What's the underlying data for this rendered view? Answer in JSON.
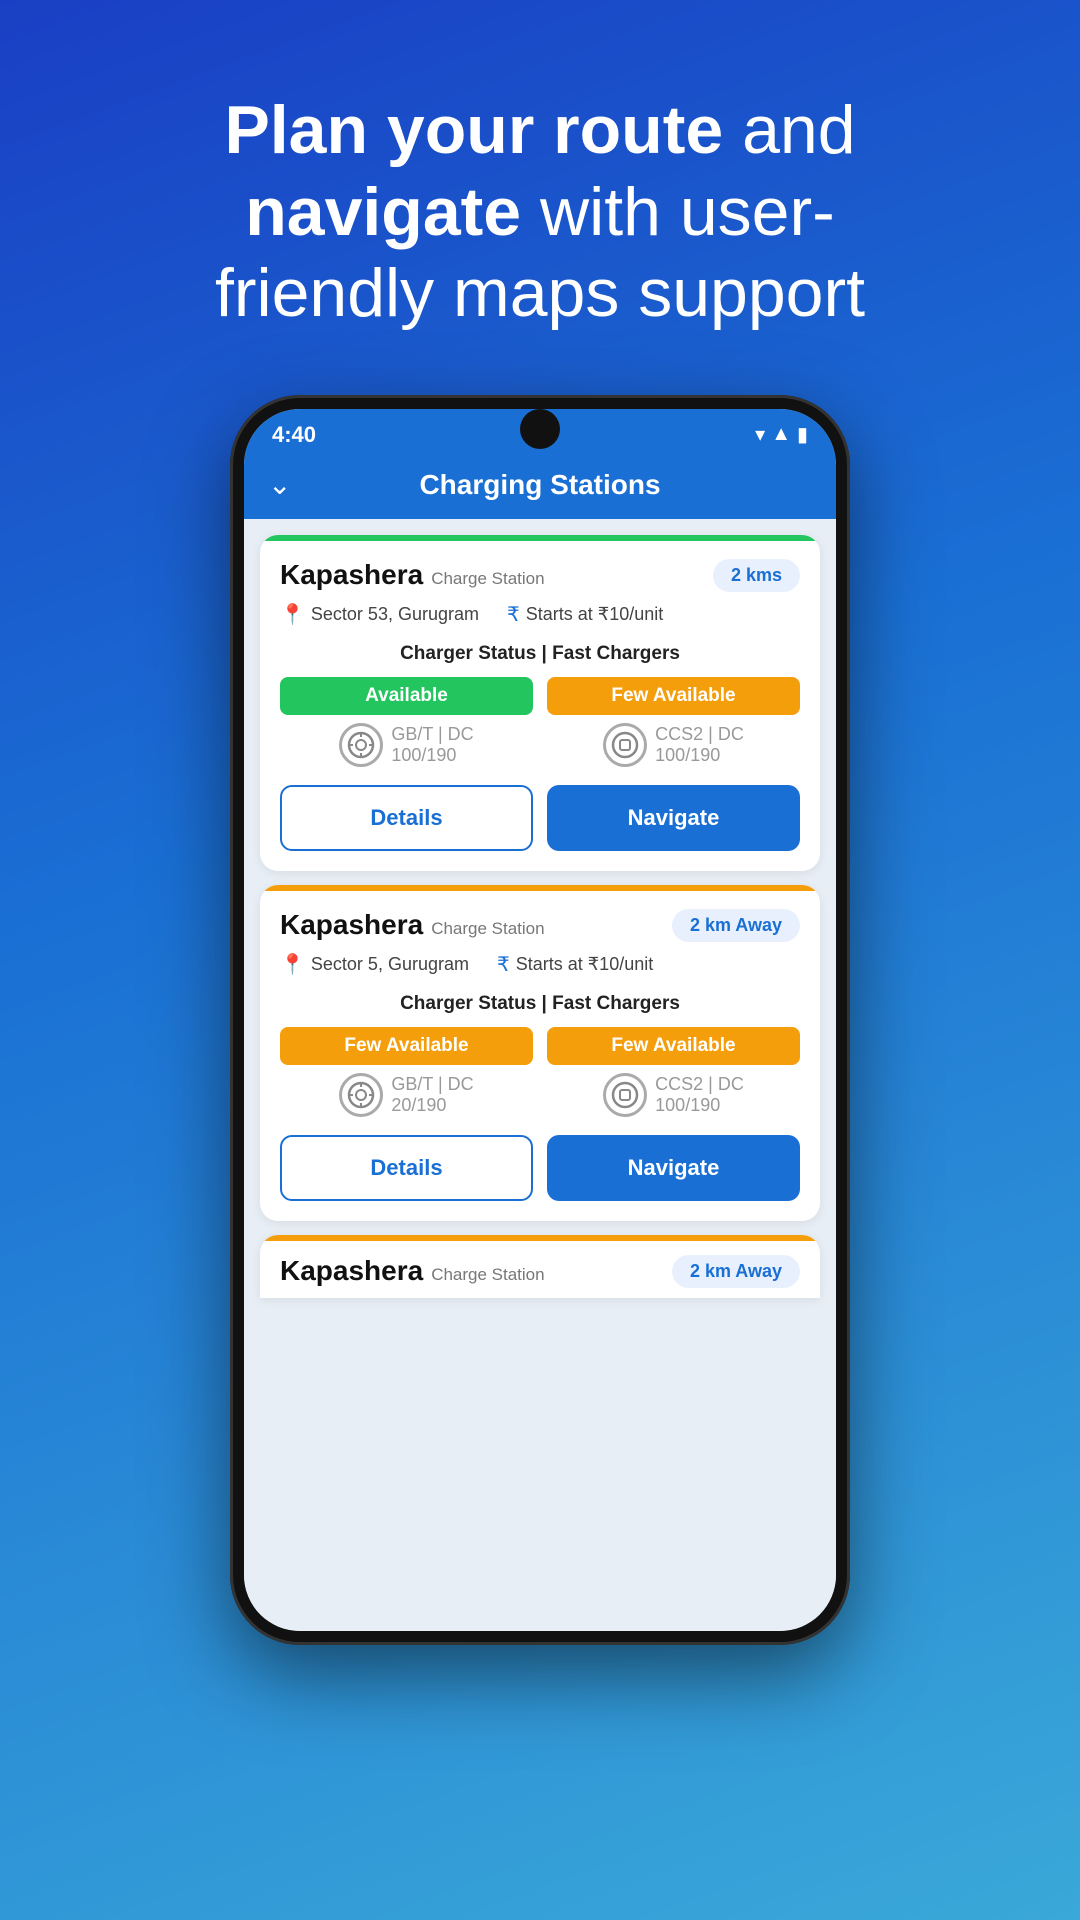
{
  "hero": {
    "title_part1": "Plan your route",
    "title_part2": "and",
    "title_part3": "navigate",
    "title_part4": "with user-friendly maps support"
  },
  "status_bar": {
    "time": "4:40",
    "wifi": "▼",
    "signal": "▲",
    "battery": "▮"
  },
  "app_header": {
    "back_icon": "⌄",
    "title": "Charging Stations"
  },
  "stations": [
    {
      "id": "station-1",
      "name": "Kapashera",
      "type": "Charge Station",
      "distance": "2 kms",
      "location": "Sector 53, Gurugram",
      "price": "Starts at ₹10/unit",
      "top_bar_color": "green",
      "charger_status_label": "Charger Status | Fast Chargers",
      "chargers": [
        {
          "status": "Available",
          "status_class": "available",
          "type": "GB/T | DC",
          "current": "100",
          "total": "190"
        },
        {
          "status": "Few Available",
          "status_class": "few-available",
          "type": "CCS2 | DC",
          "current": "100",
          "total": "190"
        }
      ],
      "details_label": "Details",
      "navigate_label": "Navigate"
    },
    {
      "id": "station-2",
      "name": "Kapashera",
      "type": "Charge Station",
      "distance": "2 km Away",
      "location": "Sector 5, Gurugram",
      "price": "Starts at ₹10/unit",
      "top_bar_color": "yellow",
      "charger_status_label": "Charger Status | Fast Chargers",
      "chargers": [
        {
          "status": "Few Available",
          "status_class": "few-available",
          "type": "GB/T | DC",
          "current": "20",
          "total": "190"
        },
        {
          "status": "Few Available",
          "status_class": "few-available",
          "type": "CCS2 | DC",
          "current": "100",
          "total": "190"
        }
      ],
      "details_label": "Details",
      "navigate_label": "Navigate"
    },
    {
      "id": "station-3",
      "name": "Kapashera",
      "type": "Charge Station",
      "distance": "2 km Away",
      "location": "",
      "price": "",
      "top_bar_color": "yellow",
      "charger_status_label": "",
      "chargers": [],
      "details_label": "",
      "navigate_label": ""
    }
  ]
}
